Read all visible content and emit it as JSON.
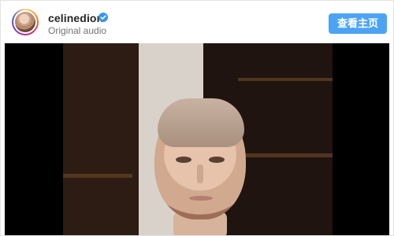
{
  "post": {
    "username": "celinedion",
    "subtitle": "Original audio",
    "profile_button_label": "查看主页",
    "verified_icon": "verified-badge-icon",
    "accent_color": "#4ca3f5"
  },
  "video": {
    "content": "portrait"
  }
}
